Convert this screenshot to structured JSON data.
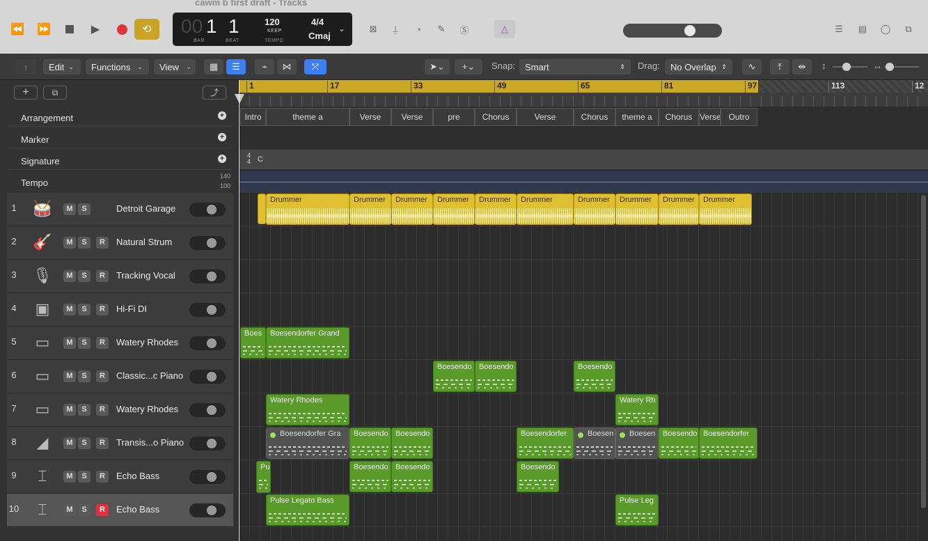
{
  "window": {
    "title": "cawm b first draft - Tracks"
  },
  "transport": {
    "bar": "1",
    "beat": "1",
    "bar_prefix": "00",
    "bar_label": "BAR",
    "beat_label": "BEAT",
    "tempo": "120",
    "tempo_mode": "KEEP",
    "tempo_label": "TEMPO",
    "time_sig": "4/4",
    "key": "Cmaj"
  },
  "toolbar": {
    "edit": "Edit",
    "functions": "Functions",
    "view": "View",
    "snap_label": "Snap:",
    "snap_value": "Smart",
    "drag_label": "Drag:",
    "drag_value": "No Overlap"
  },
  "ruler": {
    "bars": [
      "1",
      "17",
      "33",
      "49",
      "65",
      "81",
      "97",
      "113",
      "12"
    ]
  },
  "globals": {
    "arrangement": "Arrangement",
    "marker": "Marker",
    "signature": "Signature",
    "tempo": "Tempo",
    "tempo_hi": "140",
    "tempo_lo": "100",
    "sig_num": "4",
    "sig_den": "4",
    "sig_key": "C"
  },
  "arrangement": [
    {
      "name": "Intro"
    },
    {
      "name": "theme a"
    },
    {
      "name": "Verse"
    },
    {
      "name": "Verse"
    },
    {
      "name": "pre"
    },
    {
      "name": "Chorus"
    },
    {
      "name": "Verse"
    },
    {
      "name": "Chorus"
    },
    {
      "name": "theme a"
    },
    {
      "name": "Chorus"
    },
    {
      "name": "Verse"
    },
    {
      "name": "Outro"
    }
  ],
  "tracks": [
    {
      "num": "1",
      "name": "Detroit Garage",
      "m": "M",
      "s": "S",
      "r": "",
      "icon": "drum-kit-icon"
    },
    {
      "num": "2",
      "name": "Natural Strum",
      "m": "M",
      "s": "S",
      "r": "R",
      "icon": "acoustic-guitar-icon"
    },
    {
      "num": "3",
      "name": "Tracking Vocal",
      "m": "M",
      "s": "S",
      "r": "R",
      "icon": "microphone-icon"
    },
    {
      "num": "4",
      "name": "Hi-Fi DI",
      "m": "M",
      "s": "S",
      "r": "R",
      "icon": "amp-icon"
    },
    {
      "num": "5",
      "name": "Watery Rhodes",
      "m": "M",
      "s": "S",
      "r": "R",
      "icon": "piano-icon"
    },
    {
      "num": "6",
      "name": "Classic...c Piano",
      "m": "M",
      "s": "S",
      "r": "R",
      "icon": "piano-icon"
    },
    {
      "num": "7",
      "name": "Watery Rhodes",
      "m": "M",
      "s": "S",
      "r": "R",
      "icon": "piano-icon"
    },
    {
      "num": "8",
      "name": "Transis...o Piano",
      "m": "M",
      "s": "S",
      "r": "R",
      "icon": "grand-piano-icon"
    },
    {
      "num": "9",
      "name": "Echo Bass",
      "m": "M",
      "s": "S",
      "r": "R",
      "icon": "keyboard-stand-icon"
    },
    {
      "num": "10",
      "name": "Echo Bass",
      "m": "M",
      "s": "S",
      "r": "R",
      "icon": "keyboard-stand-icon"
    }
  ],
  "regions": {
    "t1": [
      "Drummer",
      "Drummer",
      "Drummer",
      "Drummer",
      "Drummer",
      "Drummer",
      "Drummer",
      "Drummer",
      "Drummer",
      "Drummer"
    ],
    "t5": [
      "Boes",
      "Boesendorfer Grand"
    ],
    "t6": [
      "Boesendo",
      "Boesendo",
      "Boesendo"
    ],
    "t7": [
      "Watery Rhodes",
      "Watery Rh"
    ],
    "t8": [
      "Boesendorfer Gra",
      "Boesendo",
      "Boesendo",
      "Boesendorfer",
      "Boesen",
      "Boesen",
      "Boesendo",
      "Boesendorfer"
    ],
    "t9": [
      "Pu",
      "Boesendo",
      "Boesendo",
      "Boesendo"
    ],
    "t10": [
      "Pulse Legato Bass",
      "Pulse Leg"
    ]
  },
  "colors": {
    "drummer": "#e0c033",
    "midi": "#5a9a2a",
    "ruler_cycle": "#c9a826",
    "record": "#e0323c",
    "cycle_btn": "#c9a226"
  }
}
